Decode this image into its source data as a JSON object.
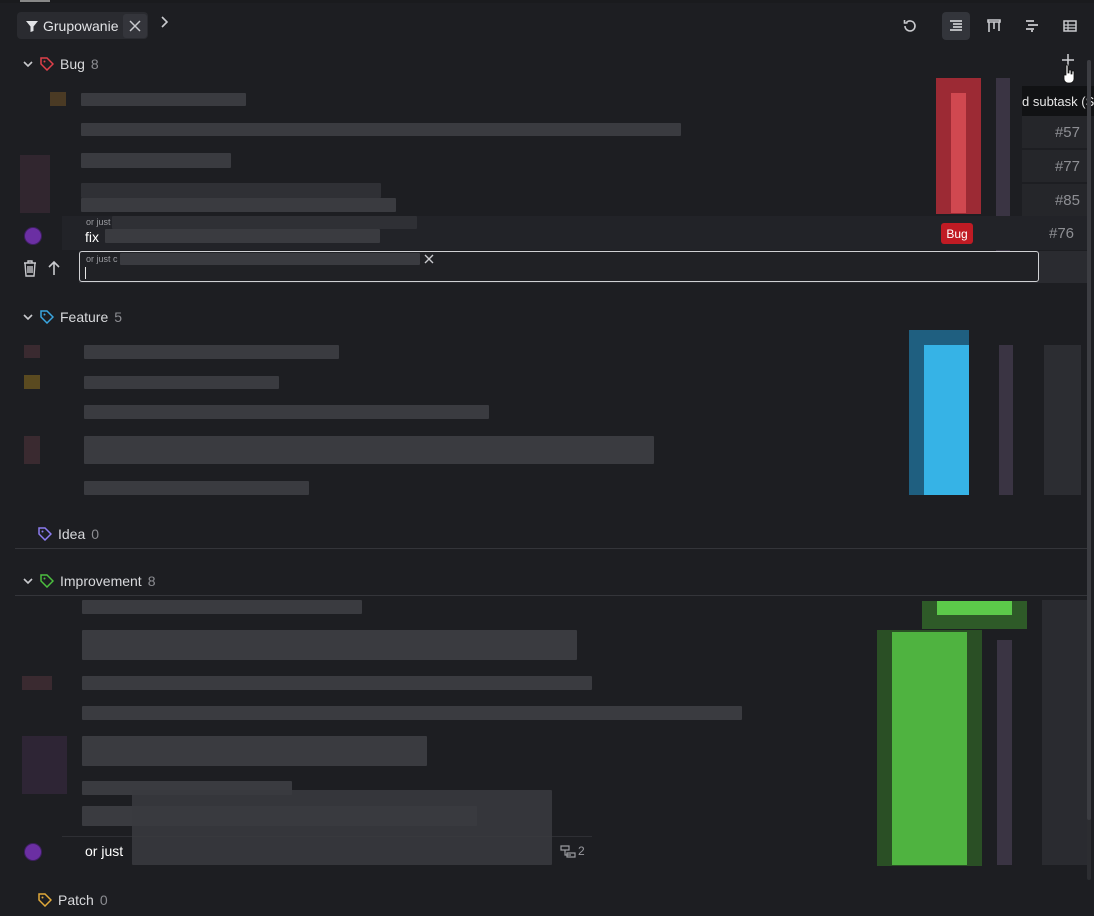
{
  "toolbar": {
    "filter_label": "Grupowanie",
    "icons": [
      "filter-icon",
      "close-icon",
      "chevron-right-icon",
      "refresh-icon",
      "list-view-icon",
      "board-view-icon",
      "gantt-view-icon",
      "table-view-icon"
    ]
  },
  "tooltip": {
    "text": "d subtask (Sh"
  },
  "groups": {
    "bug": {
      "name": "Bug",
      "count": "8",
      "color": "#e0404a"
    },
    "feature": {
      "name": "Feature",
      "count": "5",
      "color": "#3aa6e0"
    },
    "idea": {
      "name": "Idea",
      "count": "0",
      "color": "#8c7cf0"
    },
    "improvement": {
      "name": "Improvement",
      "count": "8",
      "color": "#4cbf3f"
    },
    "patch": {
      "name": "Patch",
      "count": "0",
      "color": "#e0a93a"
    }
  },
  "bug_rows": {
    "ids": [
      "#57",
      "#77",
      "#85",
      "#76"
    ],
    "row4_title_prefix": "fix",
    "row4_small_label": "or just",
    "row4_badge": "Bug"
  },
  "new_task_input": {
    "small_label": "or just c",
    "value": ""
  },
  "improvement_last": {
    "title_prefix": "or just",
    "subtask_count": "2"
  },
  "colors": {
    "accent_bug": "#c01b24",
    "accent_feature": "#36b3e6",
    "accent_improvement": "#5cc94a"
  }
}
